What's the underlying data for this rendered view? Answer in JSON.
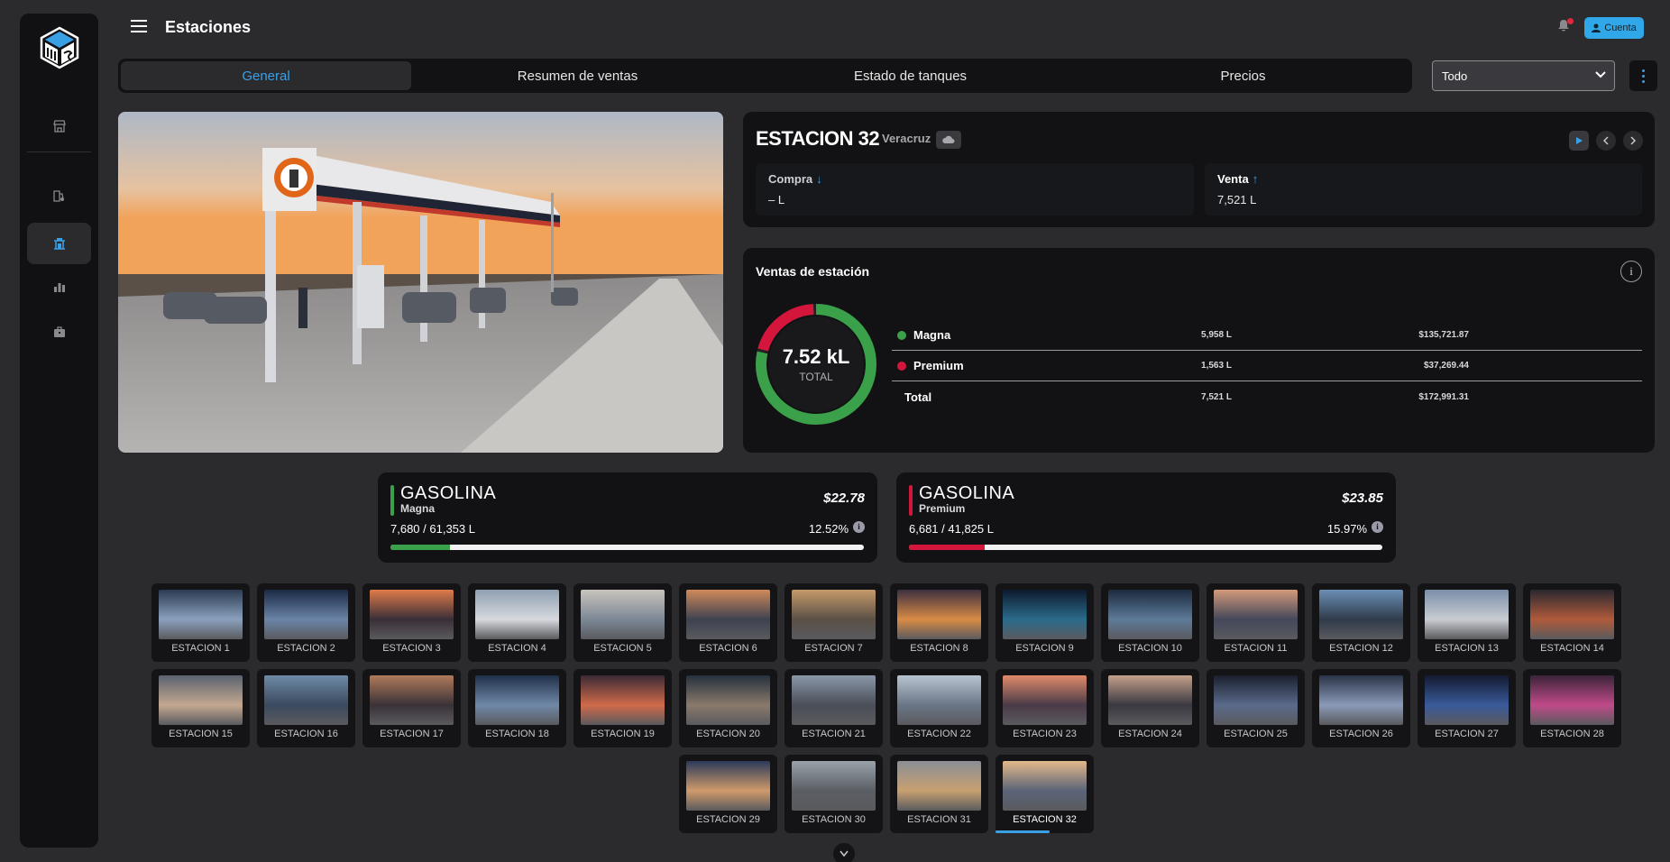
{
  "header": {
    "title": "Estaciones",
    "account_label": "Cuenta"
  },
  "sidebar": {
    "items": [
      {
        "icon": "store-icon"
      },
      {
        "icon": "fuel-pump-icon"
      },
      {
        "icon": "fuel-station-icon",
        "active": true
      },
      {
        "icon": "bar-chart-icon"
      },
      {
        "icon": "briefcase-icon"
      }
    ]
  },
  "tabs": [
    "General",
    "Resumen de ventas",
    "Estado de tanques",
    "Precios"
  ],
  "filter": {
    "selected": "Todo"
  },
  "station": {
    "name": "ESTACION 32",
    "state": "Veracruz",
    "compra": {
      "label": "Compra",
      "value": "– L"
    },
    "venta": {
      "label": "Venta",
      "value": "7,521 L"
    }
  },
  "sales": {
    "title": "Ventas de estación",
    "center_value": "7.52 kL",
    "center_label": "TOTAL",
    "rows": [
      {
        "name": "Magna",
        "liters": "5,958 L",
        "amount": "$135,721.87",
        "color": "#3aa04a"
      },
      {
        "name": "Premium",
        "liters": "1,563 L",
        "amount": "$37,269.44",
        "color": "#d4163c"
      },
      {
        "name": "Total",
        "liters": "7,521 L",
        "amount": "$172,991.31"
      }
    ],
    "donut_shares": [
      0.792,
      0.208
    ]
  },
  "fuels": [
    {
      "name": "GASOLINA",
      "type": "Magna",
      "price": "$22.78",
      "qty": "7,680 / 61,353 L",
      "pct": "12.52%",
      "fill": 0.1252,
      "color": "#3aa04a"
    },
    {
      "name": "GASOLINA",
      "type": "Premium",
      "price": "$23.85",
      "qty": "6,681 / 41,825 L",
      "pct": "15.97%",
      "fill": 0.1597,
      "color": "#d4163c"
    }
  ],
  "stations": [
    "ESTACION 1",
    "ESTACION 2",
    "ESTACION 3",
    "ESTACION 4",
    "ESTACION 5",
    "ESTACION 6",
    "ESTACION 7",
    "ESTACION 8",
    "ESTACION 9",
    "ESTACION 10",
    "ESTACION 11",
    "ESTACION 12",
    "ESTACION 13",
    "ESTACION 14",
    "ESTACION 15",
    "ESTACION 16",
    "ESTACION 17",
    "ESTACION 18",
    "ESTACION 19",
    "ESTACION 20",
    "ESTACION 21",
    "ESTACION 22",
    "ESTACION 23",
    "ESTACION 24",
    "ESTACION 25",
    "ESTACION 26",
    "ESTACION 27",
    "ESTACION 28",
    "ESTACION 29",
    "ESTACION 30",
    "ESTACION 31",
    "ESTACION 32"
  ],
  "active_station": 31,
  "colors": {
    "accent": "#3aa0e6",
    "magna": "#3aa04a",
    "premium": "#d4163c"
  }
}
